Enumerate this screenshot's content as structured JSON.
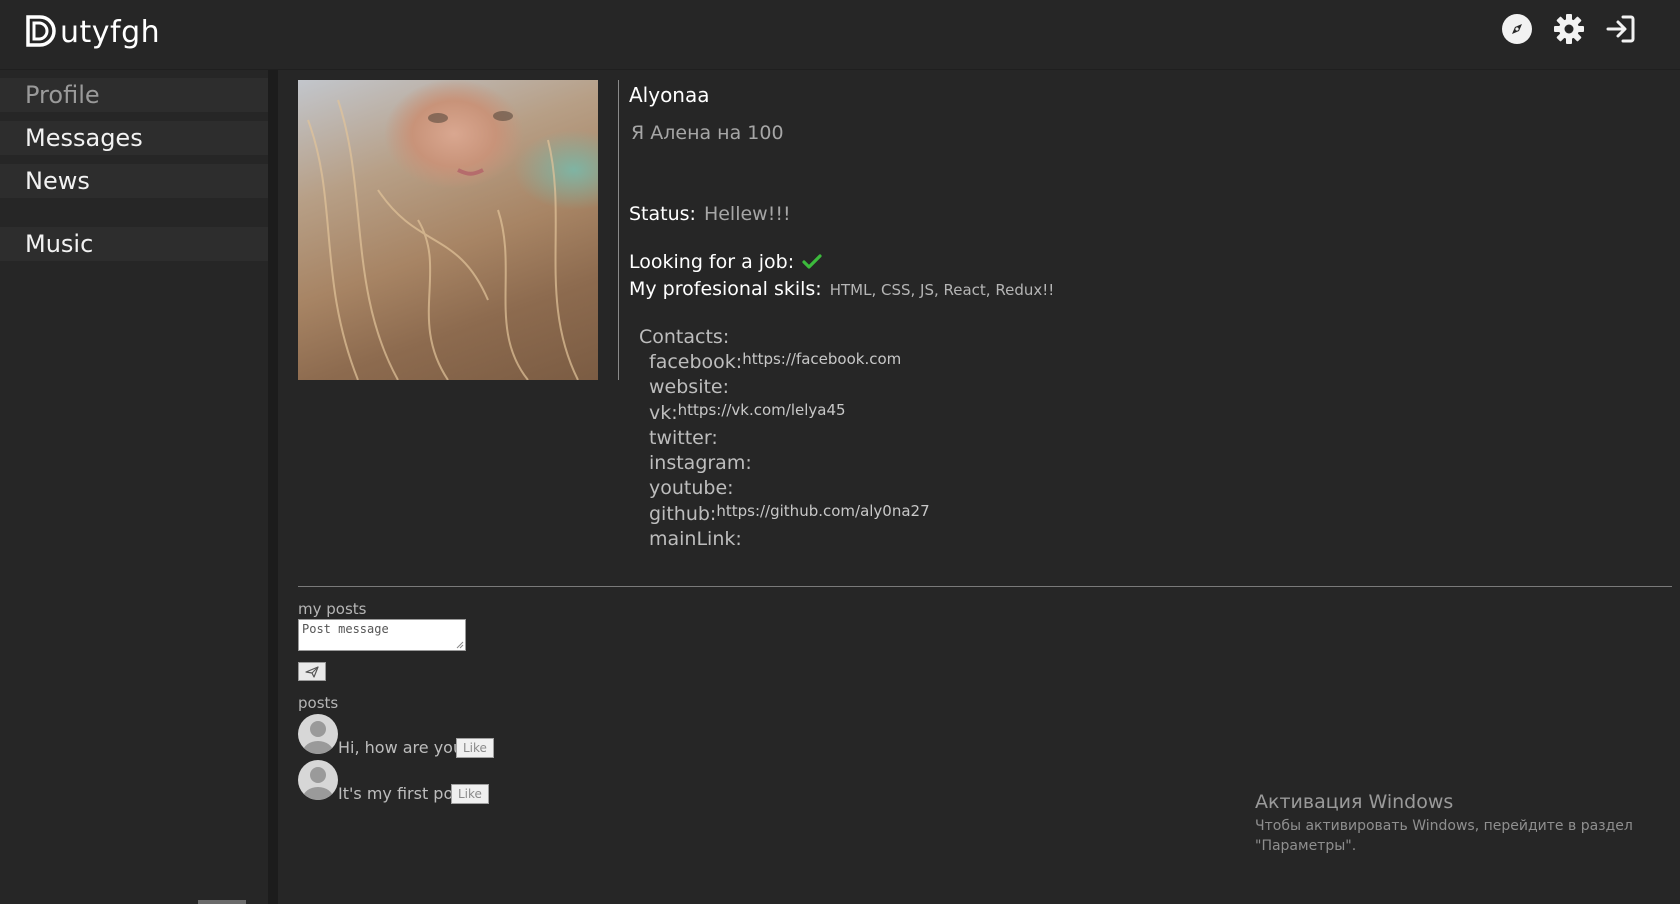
{
  "header": {
    "logo_text": "utyfgh",
    "icons": [
      "compass-icon",
      "gear-icon",
      "login-icon"
    ]
  },
  "sidebar": {
    "items": [
      {
        "label": "Profile",
        "active": true
      },
      {
        "label": "Messages"
      },
      {
        "label": "News"
      },
      {
        "label": "Music"
      }
    ]
  },
  "profile": {
    "name": "Alyonaa",
    "about": "Я Алена на 100",
    "status_label": "Status:",
    "status_value": "Hellew!!!",
    "job_label": "Looking for a job:",
    "job_value": true,
    "skills_label": "My profesional skils:",
    "skills_value": "HTML, CSS, JS, React, Redux!!"
  },
  "contacts": {
    "title": "Contacts:",
    "items": [
      {
        "label": "facebook:",
        "value": "https://facebook.com"
      },
      {
        "label": "website:",
        "value": ""
      },
      {
        "label": "vk:",
        "value": "https://vk.com/lelya45"
      },
      {
        "label": "twitter:",
        "value": ""
      },
      {
        "label": "instagram:",
        "value": ""
      },
      {
        "label": "youtube:",
        "value": ""
      },
      {
        "label": "github:",
        "value": "https://github.com/aly0na27"
      },
      {
        "label": "mainLink:",
        "value": ""
      }
    ]
  },
  "my_posts": {
    "title": "my posts",
    "placeholder": "Post message",
    "posts_title": "posts",
    "like_label": "Like",
    "posts": [
      {
        "text": "Hi, how are you?"
      },
      {
        "text": "It's my first post"
      }
    ]
  },
  "watermark": {
    "title": "Активация Windows",
    "line1": "Чтобы активировать Windows, перейдите в раздел",
    "line2": "\"Параметры\"."
  },
  "colors": {
    "background": "#262626",
    "accent_check": "#3cba3c"
  }
}
